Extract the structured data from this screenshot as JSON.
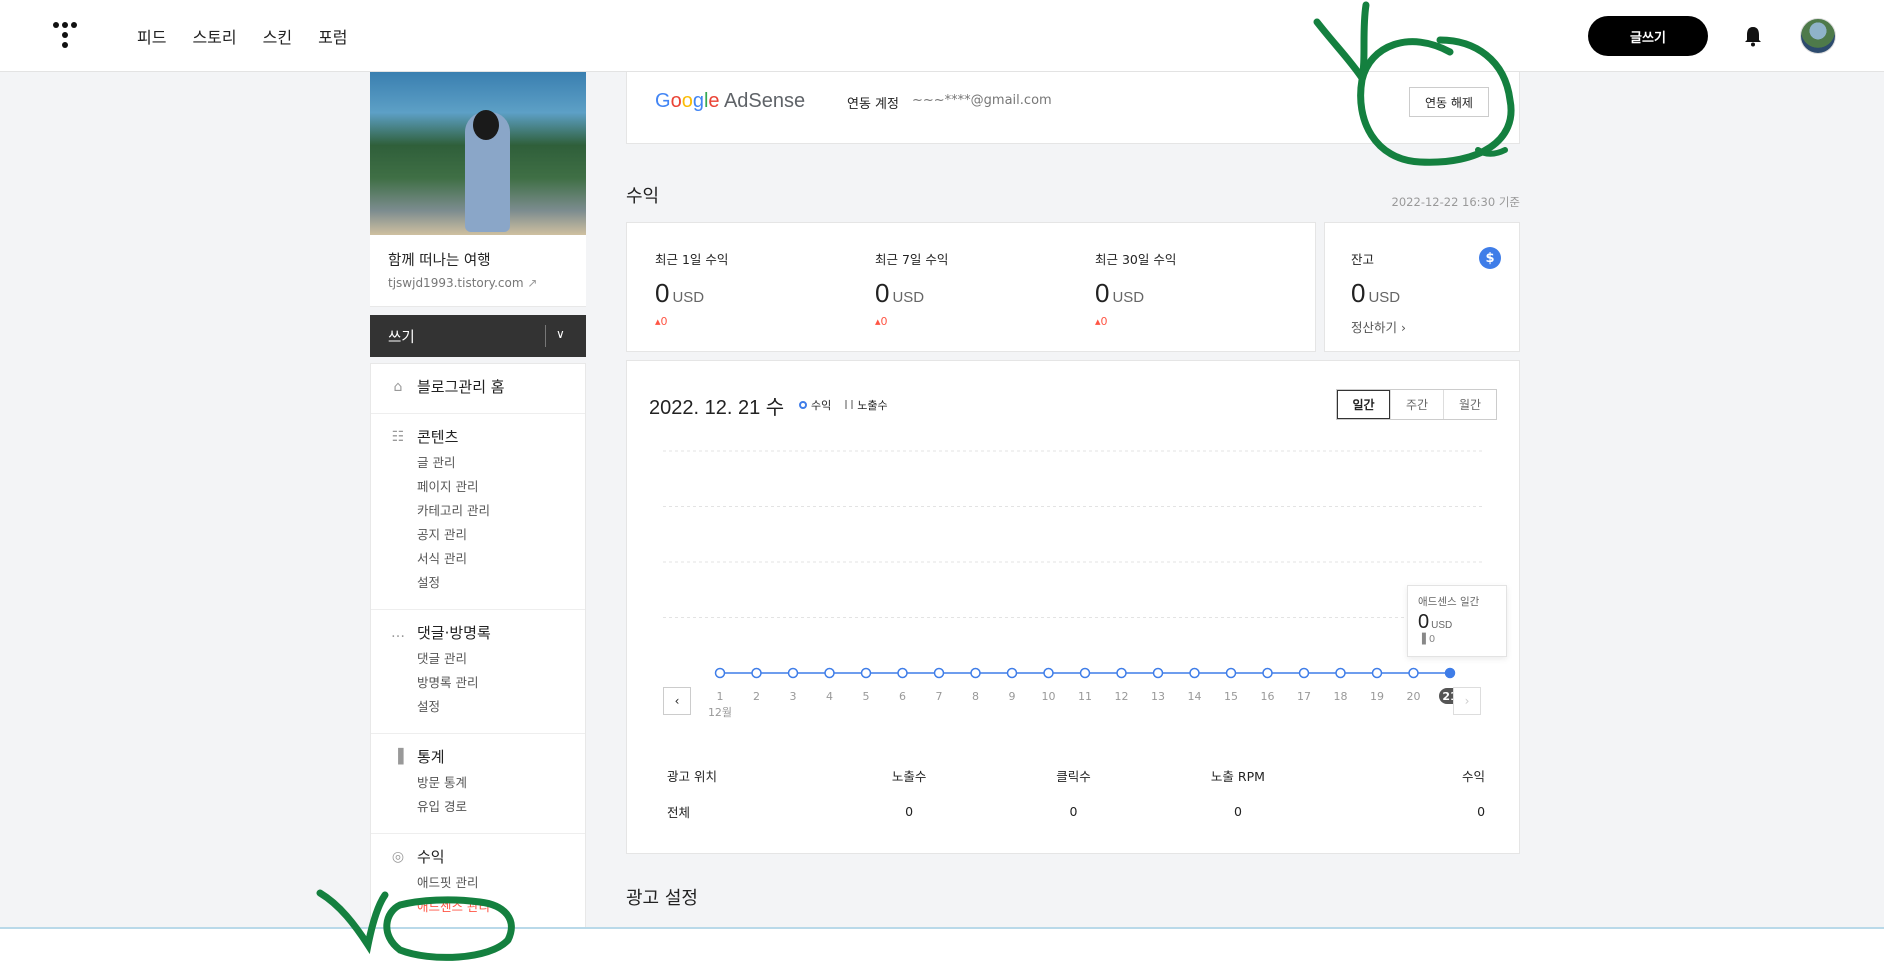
{
  "topnav": {
    "links": [
      "피드",
      "스토리",
      "스킨",
      "포럼"
    ],
    "write_label": "글쓰기"
  },
  "sidebar": {
    "blog_name": "함께 떠나는 여행",
    "blog_url": "tjswjd1993.tistory.com",
    "write_label": "쓰기",
    "groups": [
      {
        "title": "블로그관리 홈",
        "icon": "home-icon",
        "items": []
      },
      {
        "title": "콘텐츠",
        "icon": "document-icon",
        "items": [
          "글 관리",
          "페이지 관리",
          "카테고리 관리",
          "공지 관리",
          "서식 관리",
          "설정"
        ]
      },
      {
        "title": "댓글·방명록",
        "icon": "comment-icon",
        "items": [
          "댓글 관리",
          "방명록 관리",
          "설정"
        ]
      },
      {
        "title": "통계",
        "icon": "bar-chart-icon",
        "items": [
          "방문 통계",
          "유입 경로"
        ]
      },
      {
        "title": "수익",
        "icon": "coins-icon",
        "items": [
          "애드핏 관리",
          "애드센스 관리"
        ]
      }
    ],
    "active_item": "애드센스 관리"
  },
  "adsense": {
    "logo_google": "Google",
    "logo_adsense": "AdSense",
    "linked_label": "연동 계정",
    "email": "~~~****@gmail.com",
    "unlink_label": "연동 해제"
  },
  "revenue": {
    "title": "수익",
    "as_of": "2022-12-22 16:30 기준",
    "stats": [
      {
        "label": "최근 1일 수익",
        "value": "0",
        "unit": "USD",
        "delta": "0"
      },
      {
        "label": "최근 7일 수익",
        "value": "0",
        "unit": "USD",
        "delta": "0"
      },
      {
        "label": "최근 30일 수익",
        "value": "0",
        "unit": "USD",
        "delta": "0"
      }
    ],
    "balance": {
      "label": "잔고",
      "value": "0",
      "unit": "USD",
      "settle_label": "정산하기"
    }
  },
  "chart_panel": {
    "date": "2022. 12. 21 수",
    "legend_revenue": "수익",
    "legend_impressions": "노출수",
    "tabs": [
      "일간",
      "주간",
      "월간"
    ],
    "month_label": "12월",
    "tooltip": {
      "title": "애드센스 일간",
      "value": "0",
      "unit": "USD",
      "impressions": "0"
    }
  },
  "chart_data": {
    "type": "line",
    "x": [
      "1",
      "2",
      "3",
      "4",
      "5",
      "6",
      "7",
      "8",
      "9",
      "10",
      "11",
      "12",
      "13",
      "14",
      "15",
      "16",
      "17",
      "18",
      "19",
      "20",
      "21"
    ],
    "series": [
      {
        "name": "수익",
        "values": [
          0,
          0,
          0,
          0,
          0,
          0,
          0,
          0,
          0,
          0,
          0,
          0,
          0,
          0,
          0,
          0,
          0,
          0,
          0,
          0,
          0
        ]
      }
    ],
    "highlight_x": "21",
    "grid": true,
    "colors": {
      "line": "#3f7de8"
    }
  },
  "table": {
    "headers": [
      "광고 위치",
      "노출수",
      "클릭수",
      "노출 RPM",
      "수익"
    ],
    "rows": [
      [
        "전체",
        "0",
        "0",
        "0",
        "0"
      ]
    ]
  },
  "ad_settings_title": "광고 설정"
}
